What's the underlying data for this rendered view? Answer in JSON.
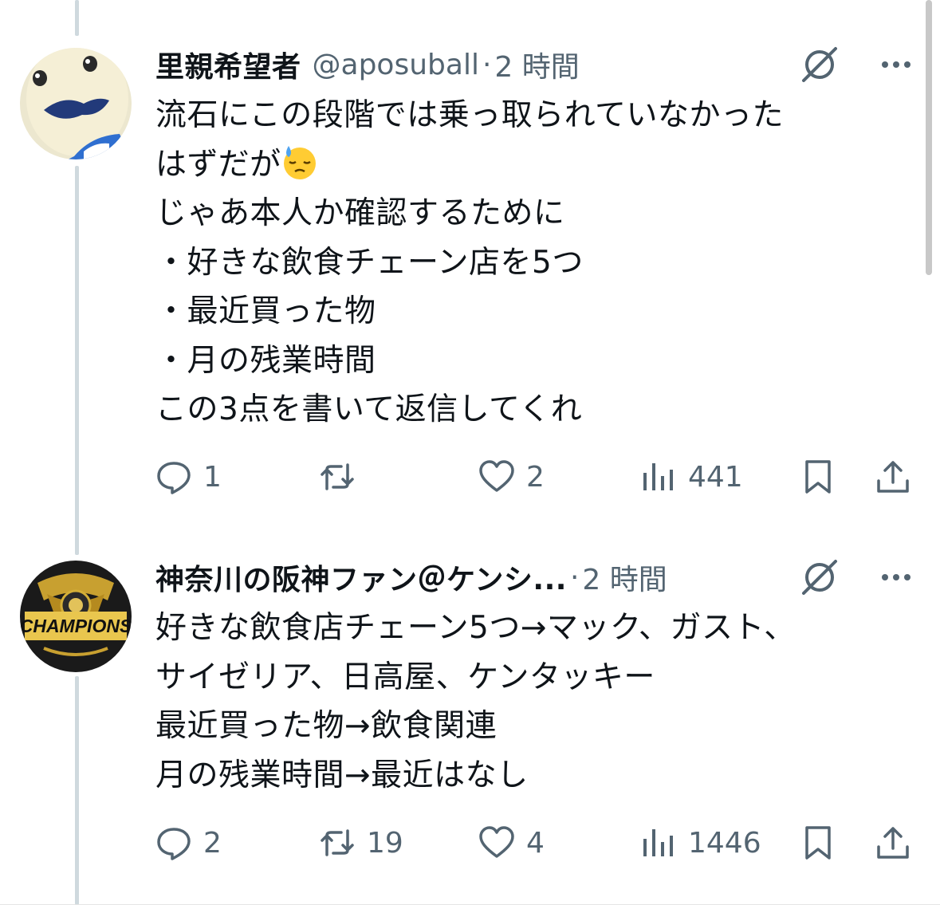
{
  "tweets": [
    {
      "name": "里親希望者",
      "handle": "@aposuball",
      "separator": "·",
      "time": "2 時間",
      "text_before_emoji": "流石にこの段階では乗っ取られていなかった\nはずだが",
      "emoji": "downcast-face-with-sweat",
      "text_after_emoji": "\nじゃあ本人か確認するために\n・好きな飲食チェーン店を5つ\n・最近買った物\n・月の残業時間\nこの3点を書いて返信してくれ",
      "stats": {
        "replies": "1",
        "retweets": "",
        "likes": "2",
        "views": "441"
      }
    },
    {
      "name": "神奈川の阪神ファン＠ケンシ...",
      "handle": "",
      "separator": "·",
      "time": "2 時間",
      "avatar_text": "CHAMPIONS",
      "text": "好きな飲食店チェーン5つ→マック、ガスト、\nサイゼリア、日高屋、ケンタッキー\n最近買った物→飲食関連\n月の残業時間→最近はなし",
      "stats": {
        "replies": "2",
        "retweets": "19",
        "likes": "4",
        "views": "1446"
      }
    }
  ],
  "icons": [
    "reply-icon",
    "retweet-icon",
    "like-icon",
    "views-icon",
    "bookmark-icon",
    "share-icon",
    "grok-icon",
    "more-icon"
  ],
  "colors": {
    "text": "#0f1419",
    "secondary": "#536471",
    "thread_line": "#cfd9de"
  }
}
